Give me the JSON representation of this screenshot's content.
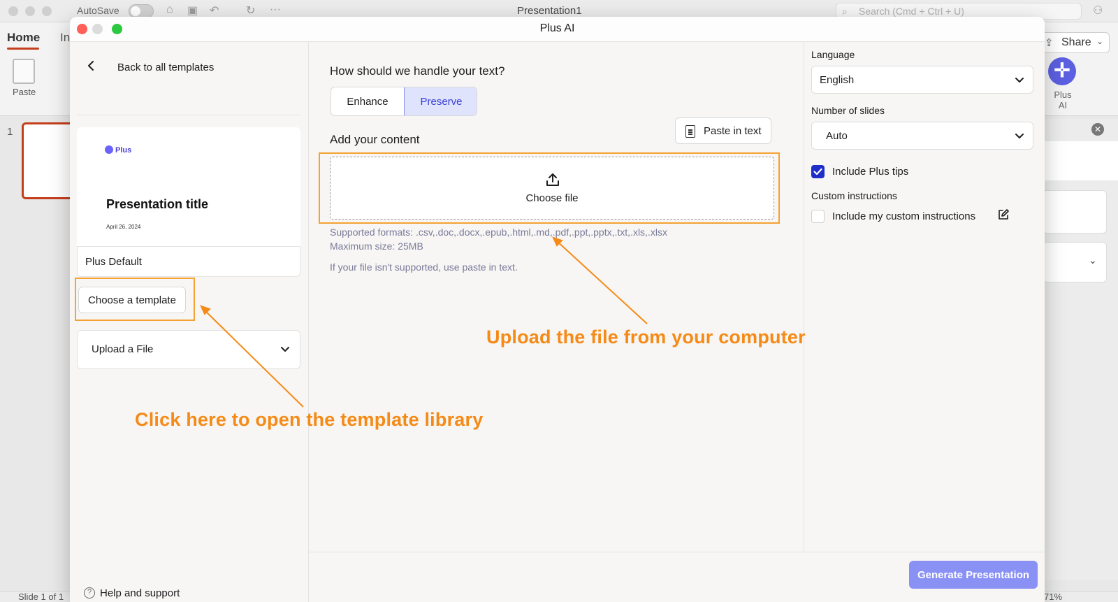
{
  "background_app": {
    "autosave_label": "AutoSave",
    "document_title": "Presentation1",
    "search_placeholder": "Search (Cmd + Ctrl + U)",
    "tabs": [
      "Home",
      "In"
    ],
    "paste_label": "Paste",
    "share_label": "Share",
    "plus_ai_label": "Plus\nAI",
    "slide_number": "1",
    "status_slide": "Slide 1 of 1",
    "status_zoom": "71%"
  },
  "modal": {
    "title": "Plus AI",
    "left": {
      "back_label": "Back to all templates",
      "template_preview": {
        "logo": "Plus",
        "title": "Presentation title",
        "date": "April 26, 2024"
      },
      "template_name": "Plus Default",
      "choose_template_label": "Choose a template",
      "upload_dropdown_label": "Upload a File",
      "help_label": "Help and support"
    },
    "middle": {
      "question": "How should we handle your text?",
      "text_modes": [
        "Enhance",
        "Preserve"
      ],
      "selected_mode": "Preserve",
      "add_content_label": "Add your content",
      "paste_label": "Paste in text",
      "choose_file_label": "Choose file",
      "supported_formats": "Supported formats: .csv,.doc,.docx,.epub,.html,.md,.pdf,.ppt,.pptx,.txt,.xls,.xlsx",
      "max_size": "Maximum size: 25MB",
      "unsupported_hint": "If your file isn't supported, use paste in text."
    },
    "right": {
      "language_label": "Language",
      "language_value": "English",
      "slides_label": "Number of slides",
      "slides_value": "Auto",
      "include_tips_label": "Include Plus tips",
      "include_tips_checked": true,
      "custom_instructions_label": "Custom instructions",
      "include_custom_label": "Include my custom instructions",
      "include_custom_checked": false
    },
    "generate_label": "Generate Presentation"
  },
  "annotations": {
    "template_hint": "Click here to open the template library",
    "upload_hint": "Upload the file from your computer",
    "color": "#f58a17"
  },
  "colors": {
    "accent": "#3a3fd6",
    "generate_button": "#8a91f5",
    "checkbox": "#1f2ec9"
  }
}
